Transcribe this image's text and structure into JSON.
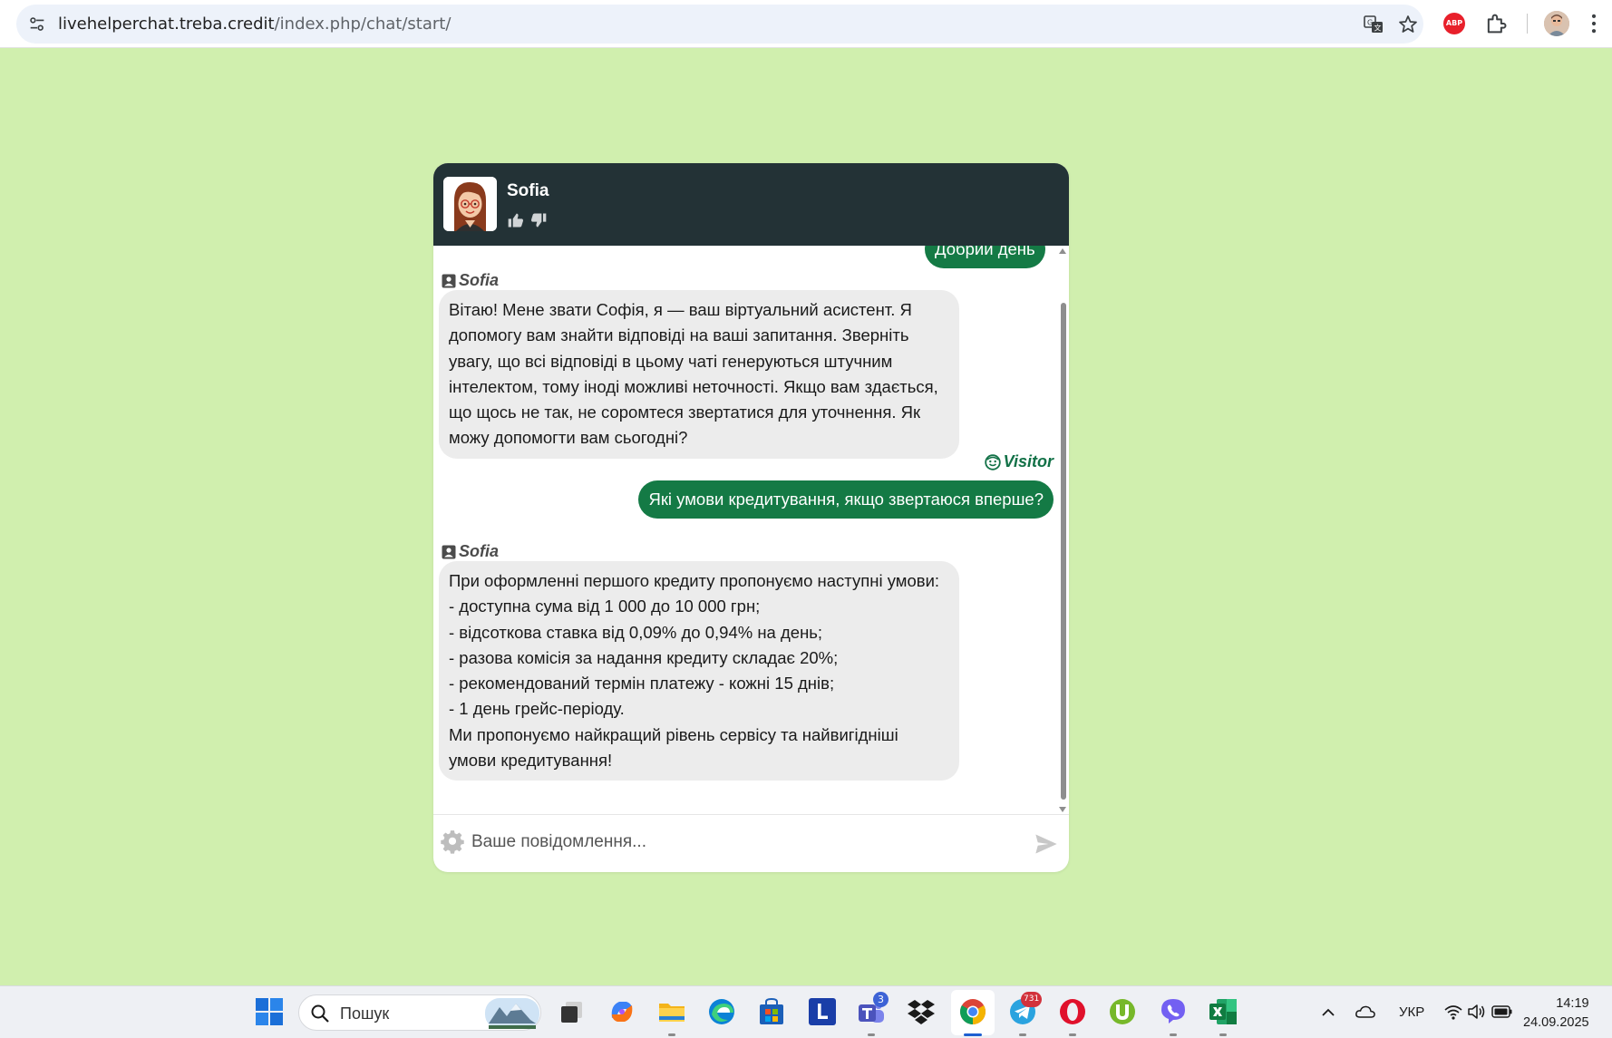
{
  "browser": {
    "url_host": "livehelperchat.treba.credit",
    "url_path": "/index.php/chat/start/"
  },
  "chat": {
    "agent_name": "Sofia",
    "header_color": "#233236",
    "previous_visitor_message": "Добрий день",
    "messages": [
      {
        "sender": "Sofia",
        "text": "Вітаю! Мене звати Софія, я — ваш віртуальний асистент. Я допомогу вам знайти відповіді на ваші запитання. Зверніть увагу, що всі відповіді в цьому чаті генеруються штучним інтелектом, тому іноді можливі неточності. Якщо вам здається, що щось не так, не соромтеся звертатися для уточнення. Як можу допомогти вам сьогодні?"
      },
      {
        "sender": "Visitor",
        "text": "Які умови кредитування, якщо звертаюся вперше?"
      },
      {
        "sender": "Sofia",
        "text": "При оформленні першого кредиту пропонуємо наступні умови:\n- доступна сума від 1 000 до 10 000 грн;\n- відсоткова ставка від 0,09% до 0,94% на день;\n- разова комісія за надання кредиту складає 20%;\n- рекомендований термін платежу - кожні 15 днів;\n- 1 день грейс-періоду.\nМи пропонуємо найкращий рівень сервісу та найвигідніші умови кредитування!"
      }
    ],
    "input_placeholder": "Ваше повідомлення...",
    "visitor_bubble_color": "#147a45"
  },
  "taskbar": {
    "search_label": "Пошук",
    "teams_badge": "3",
    "telegram_badge": "731",
    "language": "УКР",
    "time": "14:19",
    "date": "24.09.2025"
  },
  "page_background": "#d0efae"
}
